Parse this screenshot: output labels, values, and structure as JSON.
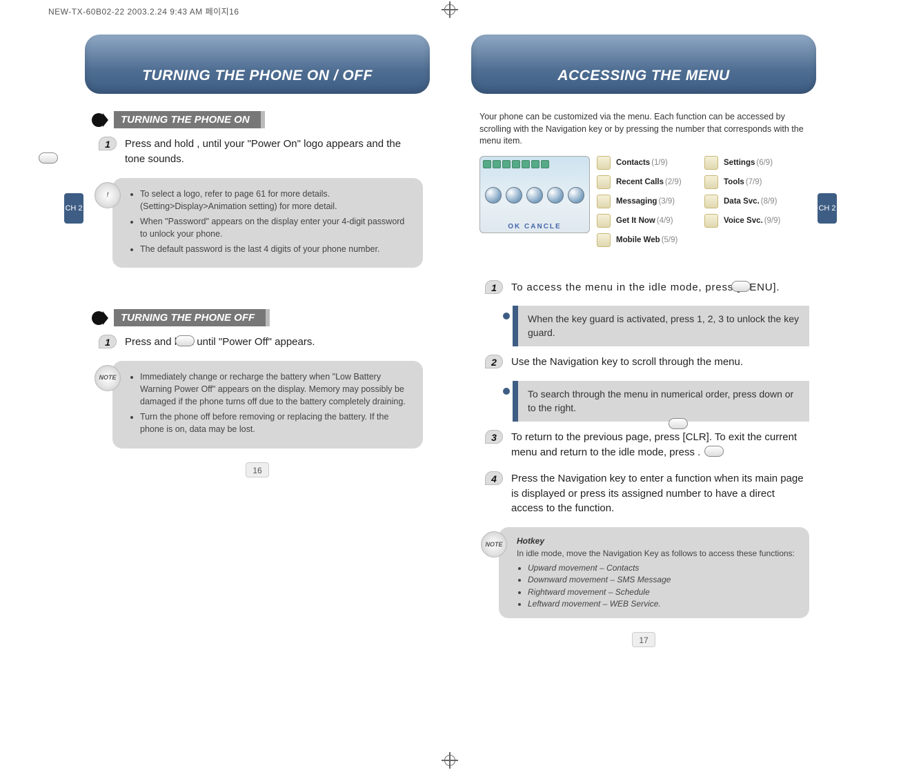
{
  "header_info": "NEW-TX-60B02-22  2003.2.24 9:43 AM  페이지16",
  "side_tab_label": "CH\n2",
  "left": {
    "banner": "TURNING THE PHONE ON / OFF",
    "section_on": "TURNING THE PHONE ON",
    "step_on": "Press and hold        , until your \"Power On\" logo appears and the tone sounds.",
    "notes_on": [
      "To select a logo, refer to page 61 for more details. (Setting>Display>Animation setting) for more detail.",
      "When \"Password\" appears on the display enter your 4-digit password to unlock your phone.",
      "The default password is the last 4 digits of your phone number."
    ],
    "section_off": "TURNING THE PHONE OFF",
    "step_off": "Press and hold        until \"Power Off\" appears.",
    "notes_off": [
      "Immediately change or recharge the battery when \"Low Battery Warning Power Off\" appears on the display. Memory may possibly be damaged if the phone turns off due to the battery completely draining.",
      "Turn the phone off before removing or replacing the battery. If the phone is on, data may be lost."
    ],
    "note_badge_on": "!",
    "note_badge_off": "NOTE",
    "page_number": "16"
  },
  "right": {
    "banner": "ACCESSING THE MENU",
    "intro": "Your phone can be customized via the menu. Each function can be accessed by scrolling with the Navigation key or by pressing the number that corresponds with the menu item.",
    "phone_bottom": "OK   CANCLE",
    "menu_items": [
      {
        "name": "Contacts",
        "num": "(1/9)"
      },
      {
        "name": "Recent Calls",
        "num": "(2/9)"
      },
      {
        "name": "Messaging",
        "num": "(3/9)"
      },
      {
        "name": "Get It Now",
        "num": "(4/9)"
      },
      {
        "name": "Mobile Web",
        "num": "(5/9)"
      },
      {
        "name": "Settings",
        "num": "(6/9)"
      },
      {
        "name": "Tools",
        "num": "(7/9)"
      },
      {
        "name": "Data Svc.",
        "num": "(8/9)"
      },
      {
        "name": "Voice Svc.",
        "num": "(9/9)"
      }
    ],
    "step1": "To access the menu in the idle mode, press       [MENU].",
    "callout1": "When the key guard is activated, press 1, 2, 3 to unlock the key guard.",
    "step2": "Use the Navigation key to scroll through the menu.",
    "callout2": "To search through the menu in numerical order, press down or to the right.",
    "step3": "To return to the previous page, press       [CLR]. To exit the current menu and return to the idle mode, press        .",
    "step4": "Press the Navigation key to enter a function when its main page is displayed or press its assigned number to have a direct access to the function.",
    "hotkey_title": "Hotkey",
    "hotkey_intro": "In idle mode, move the Navigation Key as follows to access these functions:",
    "hotkeys": [
      "Upward movement – Contacts",
      "Downward movement – SMS Message",
      "Rightward movement – Schedule",
      "Leftward movement – WEB Service."
    ],
    "note_badge": "NOTE",
    "page_number": "17"
  }
}
